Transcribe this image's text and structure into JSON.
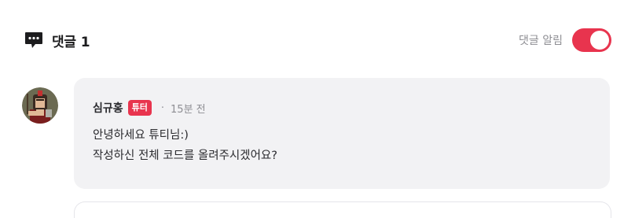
{
  "header": {
    "title": "댓글",
    "count": "1",
    "notify_label": "댓글 알림",
    "notify_on": true
  },
  "comment": {
    "author": "심규홍",
    "badge": "튜터",
    "separator": "·",
    "time": "15분 전",
    "lines": [
      "안녕하세요 튜티님:)",
      "작성하신 전체 코드를 올려주시겠어요?"
    ]
  },
  "colors": {
    "accent": "#e8344e",
    "bubble_bg": "#f2f2f4",
    "muted_text": "#8e8e93"
  },
  "icons": {
    "comment": "speech-bubble-icon",
    "avatar": "avatar-image"
  }
}
